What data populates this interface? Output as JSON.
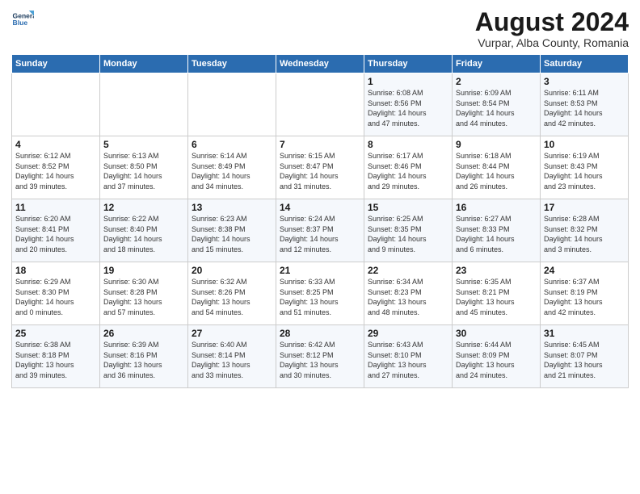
{
  "logo": {
    "line1": "General",
    "line2": "Blue"
  },
  "title": "August 2024",
  "subtitle": "Vurpar, Alba County, Romania",
  "days_header": [
    "Sunday",
    "Monday",
    "Tuesday",
    "Wednesday",
    "Thursday",
    "Friday",
    "Saturday"
  ],
  "weeks": [
    [
      {
        "num": "",
        "info": ""
      },
      {
        "num": "",
        "info": ""
      },
      {
        "num": "",
        "info": ""
      },
      {
        "num": "",
        "info": ""
      },
      {
        "num": "1",
        "info": "Sunrise: 6:08 AM\nSunset: 8:56 PM\nDaylight: 14 hours\nand 47 minutes."
      },
      {
        "num": "2",
        "info": "Sunrise: 6:09 AM\nSunset: 8:54 PM\nDaylight: 14 hours\nand 44 minutes."
      },
      {
        "num": "3",
        "info": "Sunrise: 6:11 AM\nSunset: 8:53 PM\nDaylight: 14 hours\nand 42 minutes."
      }
    ],
    [
      {
        "num": "4",
        "info": "Sunrise: 6:12 AM\nSunset: 8:52 PM\nDaylight: 14 hours\nand 39 minutes."
      },
      {
        "num": "5",
        "info": "Sunrise: 6:13 AM\nSunset: 8:50 PM\nDaylight: 14 hours\nand 37 minutes."
      },
      {
        "num": "6",
        "info": "Sunrise: 6:14 AM\nSunset: 8:49 PM\nDaylight: 14 hours\nand 34 minutes."
      },
      {
        "num": "7",
        "info": "Sunrise: 6:15 AM\nSunset: 8:47 PM\nDaylight: 14 hours\nand 31 minutes."
      },
      {
        "num": "8",
        "info": "Sunrise: 6:17 AM\nSunset: 8:46 PM\nDaylight: 14 hours\nand 29 minutes."
      },
      {
        "num": "9",
        "info": "Sunrise: 6:18 AM\nSunset: 8:44 PM\nDaylight: 14 hours\nand 26 minutes."
      },
      {
        "num": "10",
        "info": "Sunrise: 6:19 AM\nSunset: 8:43 PM\nDaylight: 14 hours\nand 23 minutes."
      }
    ],
    [
      {
        "num": "11",
        "info": "Sunrise: 6:20 AM\nSunset: 8:41 PM\nDaylight: 14 hours\nand 20 minutes."
      },
      {
        "num": "12",
        "info": "Sunrise: 6:22 AM\nSunset: 8:40 PM\nDaylight: 14 hours\nand 18 minutes."
      },
      {
        "num": "13",
        "info": "Sunrise: 6:23 AM\nSunset: 8:38 PM\nDaylight: 14 hours\nand 15 minutes."
      },
      {
        "num": "14",
        "info": "Sunrise: 6:24 AM\nSunset: 8:37 PM\nDaylight: 14 hours\nand 12 minutes."
      },
      {
        "num": "15",
        "info": "Sunrise: 6:25 AM\nSunset: 8:35 PM\nDaylight: 14 hours\nand 9 minutes."
      },
      {
        "num": "16",
        "info": "Sunrise: 6:27 AM\nSunset: 8:33 PM\nDaylight: 14 hours\nand 6 minutes."
      },
      {
        "num": "17",
        "info": "Sunrise: 6:28 AM\nSunset: 8:32 PM\nDaylight: 14 hours\nand 3 minutes."
      }
    ],
    [
      {
        "num": "18",
        "info": "Sunrise: 6:29 AM\nSunset: 8:30 PM\nDaylight: 14 hours\nand 0 minutes."
      },
      {
        "num": "19",
        "info": "Sunrise: 6:30 AM\nSunset: 8:28 PM\nDaylight: 13 hours\nand 57 minutes."
      },
      {
        "num": "20",
        "info": "Sunrise: 6:32 AM\nSunset: 8:26 PM\nDaylight: 13 hours\nand 54 minutes."
      },
      {
        "num": "21",
        "info": "Sunrise: 6:33 AM\nSunset: 8:25 PM\nDaylight: 13 hours\nand 51 minutes."
      },
      {
        "num": "22",
        "info": "Sunrise: 6:34 AM\nSunset: 8:23 PM\nDaylight: 13 hours\nand 48 minutes."
      },
      {
        "num": "23",
        "info": "Sunrise: 6:35 AM\nSunset: 8:21 PM\nDaylight: 13 hours\nand 45 minutes."
      },
      {
        "num": "24",
        "info": "Sunrise: 6:37 AM\nSunset: 8:19 PM\nDaylight: 13 hours\nand 42 minutes."
      }
    ],
    [
      {
        "num": "25",
        "info": "Sunrise: 6:38 AM\nSunset: 8:18 PM\nDaylight: 13 hours\nand 39 minutes."
      },
      {
        "num": "26",
        "info": "Sunrise: 6:39 AM\nSunset: 8:16 PM\nDaylight: 13 hours\nand 36 minutes."
      },
      {
        "num": "27",
        "info": "Sunrise: 6:40 AM\nSunset: 8:14 PM\nDaylight: 13 hours\nand 33 minutes."
      },
      {
        "num": "28",
        "info": "Sunrise: 6:42 AM\nSunset: 8:12 PM\nDaylight: 13 hours\nand 30 minutes."
      },
      {
        "num": "29",
        "info": "Sunrise: 6:43 AM\nSunset: 8:10 PM\nDaylight: 13 hours\nand 27 minutes."
      },
      {
        "num": "30",
        "info": "Sunrise: 6:44 AM\nSunset: 8:09 PM\nDaylight: 13 hours\nand 24 minutes."
      },
      {
        "num": "31",
        "info": "Sunrise: 6:45 AM\nSunset: 8:07 PM\nDaylight: 13 hours\nand 21 minutes."
      }
    ]
  ]
}
